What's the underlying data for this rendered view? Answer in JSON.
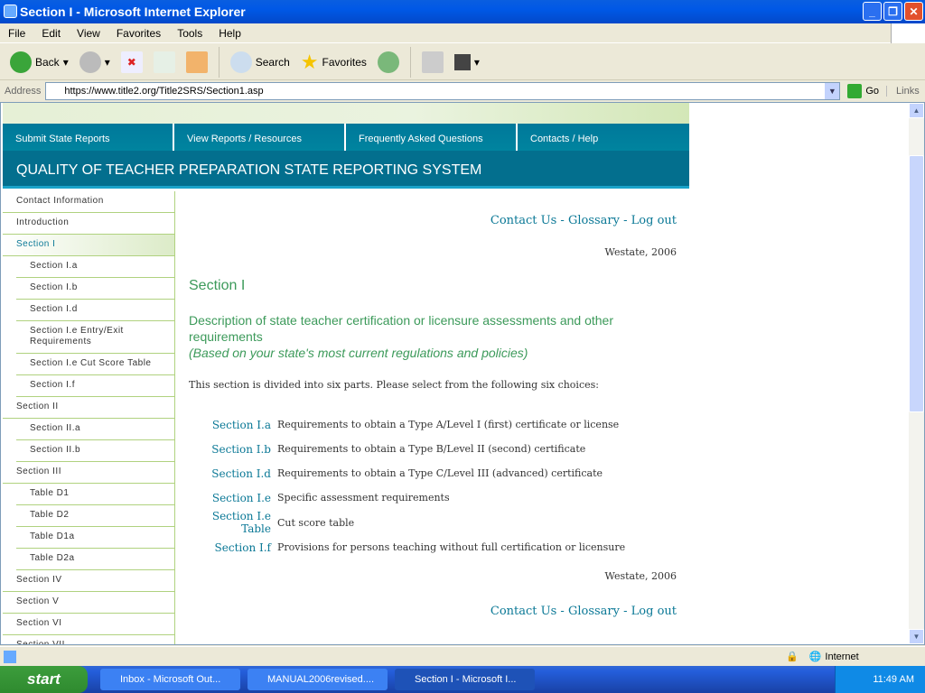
{
  "window": {
    "title": "Section I - Microsoft Internet Explorer"
  },
  "menu": [
    "File",
    "Edit",
    "View",
    "Favorites",
    "Tools",
    "Help"
  ],
  "toolbar": {
    "back": "Back",
    "search": "Search",
    "favorites": "Favorites"
  },
  "address": {
    "label": "Address",
    "url": "https://www.title2.org/Title2SRS/Section1.asp",
    "go": "Go",
    "links": "Links"
  },
  "nav": [
    "Submit State Reports",
    "View Reports / Resources",
    "Frequently Asked Questions",
    "Contacts / Help"
  ],
  "banner": "QUALITY OF TEACHER PREPARATION STATE REPORTING SYSTEM",
  "sidebar": [
    {
      "label": "Contact Information",
      "level": 1
    },
    {
      "label": "Introduction",
      "level": 1
    },
    {
      "label": "Section I",
      "level": 1,
      "active": true
    },
    {
      "label": "Section I.a",
      "level": 2
    },
    {
      "label": "Section I.b",
      "level": 2
    },
    {
      "label": "Section I.d",
      "level": 2
    },
    {
      "label": "Section I.e Entry/Exit Requirements",
      "level": 2
    },
    {
      "label": "Section I.e Cut Score Table",
      "level": 2
    },
    {
      "label": "Section I.f",
      "level": 2
    },
    {
      "label": "Section II",
      "level": 1
    },
    {
      "label": "Section II.a",
      "level": 2
    },
    {
      "label": "Section II.b",
      "level": 2
    },
    {
      "label": "Section III",
      "level": 1
    },
    {
      "label": "Table D1",
      "level": 2
    },
    {
      "label": "Table D2",
      "level": 2
    },
    {
      "label": "Table D1a",
      "level": 2
    },
    {
      "label": "Table D2a",
      "level": 2
    },
    {
      "label": "Section IV",
      "level": 1
    },
    {
      "label": "Section V",
      "level": 1
    },
    {
      "label": "Section VI",
      "level": 1
    },
    {
      "label": "Section VII",
      "level": 1
    }
  ],
  "main": {
    "links": {
      "contact": "Contact Us",
      "glossary": "Glossary",
      "logout": "Log out",
      "sep": " - "
    },
    "state_year": "Westate, 2006",
    "heading": "Section I",
    "description": "Description of state teacher certification or licensure assessments and other requirements",
    "note": "(Based on your state's most current regulations and policies)",
    "intro": "This section is divided into six parts. Please select from the following six choices:",
    "parts": [
      {
        "link": "Section I.a",
        "text": "Requirements to obtain a Type A/Level I (first) certificate or license"
      },
      {
        "link": "Section I.b",
        "text": "Requirements to obtain a Type B/Level II (second) certificate"
      },
      {
        "link": "Section I.d",
        "text": "Requirements to obtain a Type C/Level III (advanced) certificate"
      },
      {
        "link": "Section I.e",
        "text": "Specific assessment requirements"
      },
      {
        "link": "Section I.e Table",
        "text": "Cut score table"
      },
      {
        "link": "Section I.f",
        "text": "Provisions for persons teaching without full certification or licensure"
      }
    ]
  },
  "status": {
    "zone": "Internet"
  },
  "taskbar": {
    "start": "start",
    "tasks": [
      "Inbox - Microsoft Out...",
      "MANUAL2006revised....",
      "Section I - Microsoft I..."
    ],
    "clock": "11:49 AM"
  }
}
